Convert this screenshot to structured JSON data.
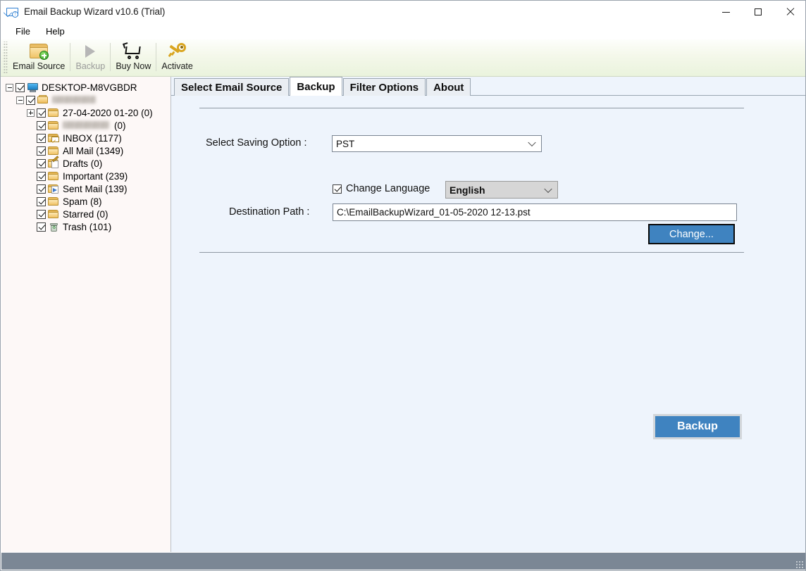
{
  "window": {
    "title": "Email Backup Wizard v10.6 (Trial)",
    "icon": "envelope-app-icon",
    "controls": {
      "minimize": "minimize-icon",
      "maximize": "maximize-icon",
      "close": "close-icon"
    }
  },
  "menubar": {
    "items": [
      {
        "label": "File"
      },
      {
        "label": "Help"
      }
    ]
  },
  "toolbar": {
    "buttons": [
      {
        "label": "Email Source",
        "icon": "folder-add-icon",
        "enabled": true
      },
      {
        "label": "Backup",
        "icon": "play-icon",
        "enabled": false
      },
      {
        "label": "Buy Now",
        "icon": "shopping-cart-icon",
        "enabled": true
      },
      {
        "label": "Activate",
        "icon": "key-icon",
        "enabled": true
      }
    ]
  },
  "sidebar": {
    "tree": [
      {
        "label": "DESKTOP-M8VGBDR",
        "depth": 0,
        "expander": "minus",
        "checked": true,
        "icon": "monitor-icon",
        "redacted": false
      },
      {
        "label": "",
        "depth": 1,
        "expander": "minus",
        "checked": true,
        "icon": "account-icon",
        "redacted": true,
        "redacted_width": 62
      },
      {
        "label": "27-04-2020 01-20 (0)",
        "depth": 2,
        "expander": "plus",
        "checked": true,
        "icon": "folder-icon",
        "redacted": false
      },
      {
        "label": "(0)",
        "depth": 2,
        "expander": "none",
        "checked": true,
        "icon": "folder-icon",
        "redacted": true,
        "redacted_width": 66
      },
      {
        "label": "INBOX (1177)",
        "depth": 2,
        "expander": "none",
        "checked": true,
        "icon": "folder-inbox-icon",
        "redacted": false
      },
      {
        "label": "All Mail (1349)",
        "depth": 2,
        "expander": "none",
        "checked": true,
        "icon": "folder-icon",
        "redacted": false
      },
      {
        "label": "Drafts (0)",
        "depth": 2,
        "expander": "none",
        "checked": true,
        "icon": "folder-drafts-icon",
        "redacted": false
      },
      {
        "label": "Important (239)",
        "depth": 2,
        "expander": "none",
        "checked": true,
        "icon": "folder-icon",
        "redacted": false
      },
      {
        "label": "Sent Mail (139)",
        "depth": 2,
        "expander": "none",
        "checked": true,
        "icon": "folder-sent-icon",
        "redacted": false
      },
      {
        "label": "Spam (8)",
        "depth": 2,
        "expander": "none",
        "checked": true,
        "icon": "folder-icon",
        "redacted": false
      },
      {
        "label": "Starred (0)",
        "depth": 2,
        "expander": "none",
        "checked": true,
        "icon": "folder-icon",
        "redacted": false
      },
      {
        "label": "Trash (101)",
        "depth": 2,
        "expander": "none",
        "checked": true,
        "icon": "folder-trash-icon",
        "redacted": false
      }
    ]
  },
  "main": {
    "tabs": [
      {
        "label": "Select Email Source",
        "active": false
      },
      {
        "label": "Backup",
        "active": true
      },
      {
        "label": "Filter Options",
        "active": false
      },
      {
        "label": "About",
        "active": false
      }
    ],
    "form": {
      "saving_option_label": "Select Saving Option :",
      "saving_option_value": "PST",
      "change_language_label": "Change Language",
      "change_language_checked": true,
      "language_value": "English",
      "destination_path_label": "Destination Path :",
      "destination_path_value": "C:\\EmailBackupWizard_01-05-2020 12-13.pst",
      "change_button_label": "Change...",
      "backup_button_label": "Backup"
    }
  },
  "colors": {
    "accent_blue": "#3f83c0",
    "panel_background": "#eef4fc",
    "sidebar_background": "#fdf8f7",
    "statusbar": "#7b8795",
    "toolbar_gradient_end": "#eaf3dd"
  }
}
